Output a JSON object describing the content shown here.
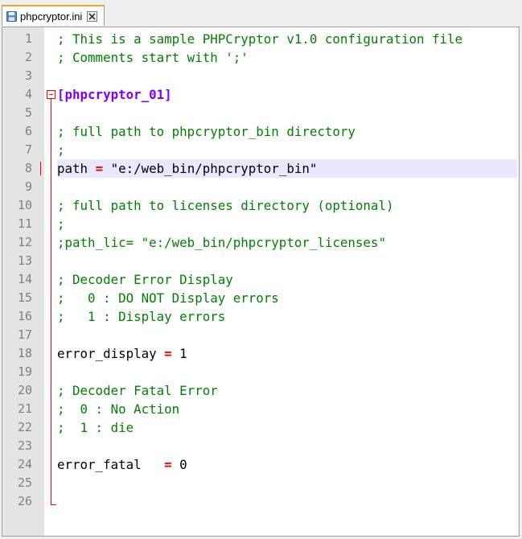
{
  "tab": {
    "filename": "phpcryptor.ini"
  },
  "icons": {
    "save": "floppy-save-icon",
    "close": "close-x-icon"
  },
  "colors": {
    "comment": "#008000",
    "section": "#8000ff",
    "operator": "#ff0000",
    "line_number": "#808080",
    "current_line": "#e8e8ff",
    "gutter": "#e4e4e4",
    "tab_accent": "#f3a32c"
  },
  "lines": [
    {
      "num": "1",
      "segments": [
        {
          "t": "; This is a sample PHPCryptor v1.0 configuration file",
          "s": "comment"
        }
      ]
    },
    {
      "num": "2",
      "segments": [
        {
          "t": "; Comments start with ';'",
          "s": "comment"
        }
      ]
    },
    {
      "num": "3",
      "segments": []
    },
    {
      "num": "4",
      "segments": [
        {
          "t": "[phpcryptor_01]",
          "s": "section"
        }
      ]
    },
    {
      "num": "5",
      "segments": []
    },
    {
      "num": "6",
      "segments": [
        {
          "t": "; full path to phpcryptor_bin directory",
          "s": "comment"
        }
      ]
    },
    {
      "num": "7",
      "segments": [
        {
          "t": ";",
          "s": "comment"
        }
      ]
    },
    {
      "num": "8",
      "segments": [
        {
          "t": "path ",
          "s": "text"
        },
        {
          "t": "=",
          "s": "op"
        },
        {
          "t": " \"e:/web_bin/phpcryptor_bin\"",
          "s": "text"
        }
      ],
      "current": true
    },
    {
      "num": "9",
      "segments": []
    },
    {
      "num": "10",
      "segments": [
        {
          "t": "; full path to licenses directory (optional)",
          "s": "comment"
        }
      ]
    },
    {
      "num": "11",
      "segments": [
        {
          "t": ";",
          "s": "comment"
        }
      ]
    },
    {
      "num": "12",
      "segments": [
        {
          "t": ";path_lic= \"e:/web_bin/phpcryptor_licenses\"",
          "s": "comment"
        }
      ]
    },
    {
      "num": "13",
      "segments": []
    },
    {
      "num": "14",
      "segments": [
        {
          "t": "; Decoder Error Display",
          "s": "comment"
        }
      ]
    },
    {
      "num": "15",
      "segments": [
        {
          "t": ";   0 : DO NOT Display errors",
          "s": "comment"
        }
      ]
    },
    {
      "num": "16",
      "segments": [
        {
          "t": ";   1 : Display errors",
          "s": "comment"
        }
      ]
    },
    {
      "num": "17",
      "segments": []
    },
    {
      "num": "18",
      "segments": [
        {
          "t": "error_display ",
          "s": "text"
        },
        {
          "t": "=",
          "s": "op"
        },
        {
          "t": " 1",
          "s": "text"
        }
      ]
    },
    {
      "num": "19",
      "segments": []
    },
    {
      "num": "20",
      "segments": [
        {
          "t": "; Decoder Fatal Error",
          "s": "comment"
        }
      ]
    },
    {
      "num": "21",
      "segments": [
        {
          "t": ";  0 : No Action",
          "s": "comment"
        }
      ]
    },
    {
      "num": "22",
      "segments": [
        {
          "t": ";  1 : die",
          "s": "comment"
        }
      ]
    },
    {
      "num": "23",
      "segments": []
    },
    {
      "num": "24",
      "segments": [
        {
          "t": "error_fatal   ",
          "s": "text"
        },
        {
          "t": "=",
          "s": "op"
        },
        {
          "t": " 0",
          "s": "text"
        }
      ]
    },
    {
      "num": "25",
      "segments": []
    },
    {
      "num": "26",
      "segments": []
    }
  ]
}
